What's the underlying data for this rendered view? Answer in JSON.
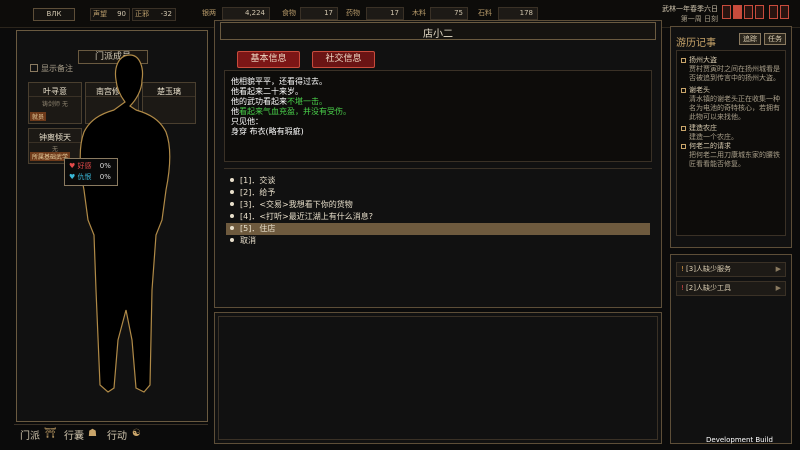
{
  "top_bar": {
    "left_box1": "ВЛК",
    "rep_label": "声望",
    "rep_value": "90",
    "right_label": "正邪",
    "right_value": "-32"
  },
  "resources": [
    {
      "label": "银两",
      "value": "4,224"
    },
    {
      "label": "食物",
      "value": "17"
    },
    {
      "label": "药物",
      "value": "17"
    },
    {
      "label": "木料",
      "value": "75"
    },
    {
      "label": "石料",
      "value": "178"
    }
  ],
  "date": {
    "line1": "武林一年春季六日",
    "line2": "第一周 日刻"
  },
  "sidebar": {
    "title": "门派成员",
    "show_notes": "显示备注",
    "cards": [
      {
        "name": "叶寻意",
        "sub": "铸剑师 无",
        "tag": "就员"
      },
      {
        "name": "南宫修竹",
        "sub": "",
        "tag": ""
      },
      {
        "name": "楚玉璃",
        "sub": "",
        "tag": ""
      },
      {
        "name": "钟离倾天",
        "sub": "无",
        "tag": "所属基础武学"
      }
    ]
  },
  "tooltip": {
    "favor_label": "好感",
    "favor_value": "0%",
    "hate_label": "仇恨",
    "hate_value": "0%"
  },
  "bottom_tabs": {
    "tab1": "门派",
    "tab2": "行囊",
    "tab3": "行动"
  },
  "dialog": {
    "npc_name": "店小二",
    "btn_basic": "基本信息",
    "btn_social": "社交信息",
    "lines": [
      {
        "t": "他相貌平平，还看得过去。",
        "c": "#ffffff"
      },
      {
        "t": "他看起来二十来岁。",
        "c": "#ffffff"
      },
      {
        "t": "他的武功看起来",
        "c": "#ffffff",
        "h": "不堪一击。",
        "hc": "#49d04a"
      },
      {
        "t": "他",
        "c": "#ffffff",
        "h": "看起来气血充盈，并没有受伤。",
        "hc": "#49d04a"
      },
      {
        "t": "只见他：",
        "c": "#ffffff"
      },
      {
        "t": "    身穿 布衣(略有瑕疵)",
        "c": "#ffffff"
      }
    ],
    "options": [
      "[1]．交谈",
      "[2]．给予",
      "[3]．<交易>我想看下你的货物",
      "[4]．<打听>最近江湖上有什么消息?",
      "[5]．住店",
      "取消"
    ],
    "selected_option_index": 4
  },
  "log": {
    "title": "游历记事",
    "btn1": "追踪",
    "btn2": "任务",
    "entries": [
      {
        "title": "扬州大盗",
        "body": "贾村贾寅时之间在扬州城看是否被追到传言中的扬州大盗。"
      },
      {
        "title": "谢老头",
        "body": "清水镇的谢老头正在收集一种名为电池的奇特核心，若拥有此物可以来找他。"
      },
      {
        "title": "建造农庄",
        "body": "建造一个农庄。"
      },
      {
        "title": "何老二的请求",
        "body": "把何老二用刀康城东家的腰铁匠看看能否修复。"
      }
    ],
    "alerts": [
      {
        "text": "[3]人缺少服务"
      },
      {
        "text": "[2]人缺少工具"
      }
    ]
  },
  "build_label": "Development Build",
  "colors": {
    "accent": "#c9a56a",
    "red_button": "#7c1616",
    "highlight_green": "#49d04a",
    "selected_row": "#6e5a3e"
  }
}
